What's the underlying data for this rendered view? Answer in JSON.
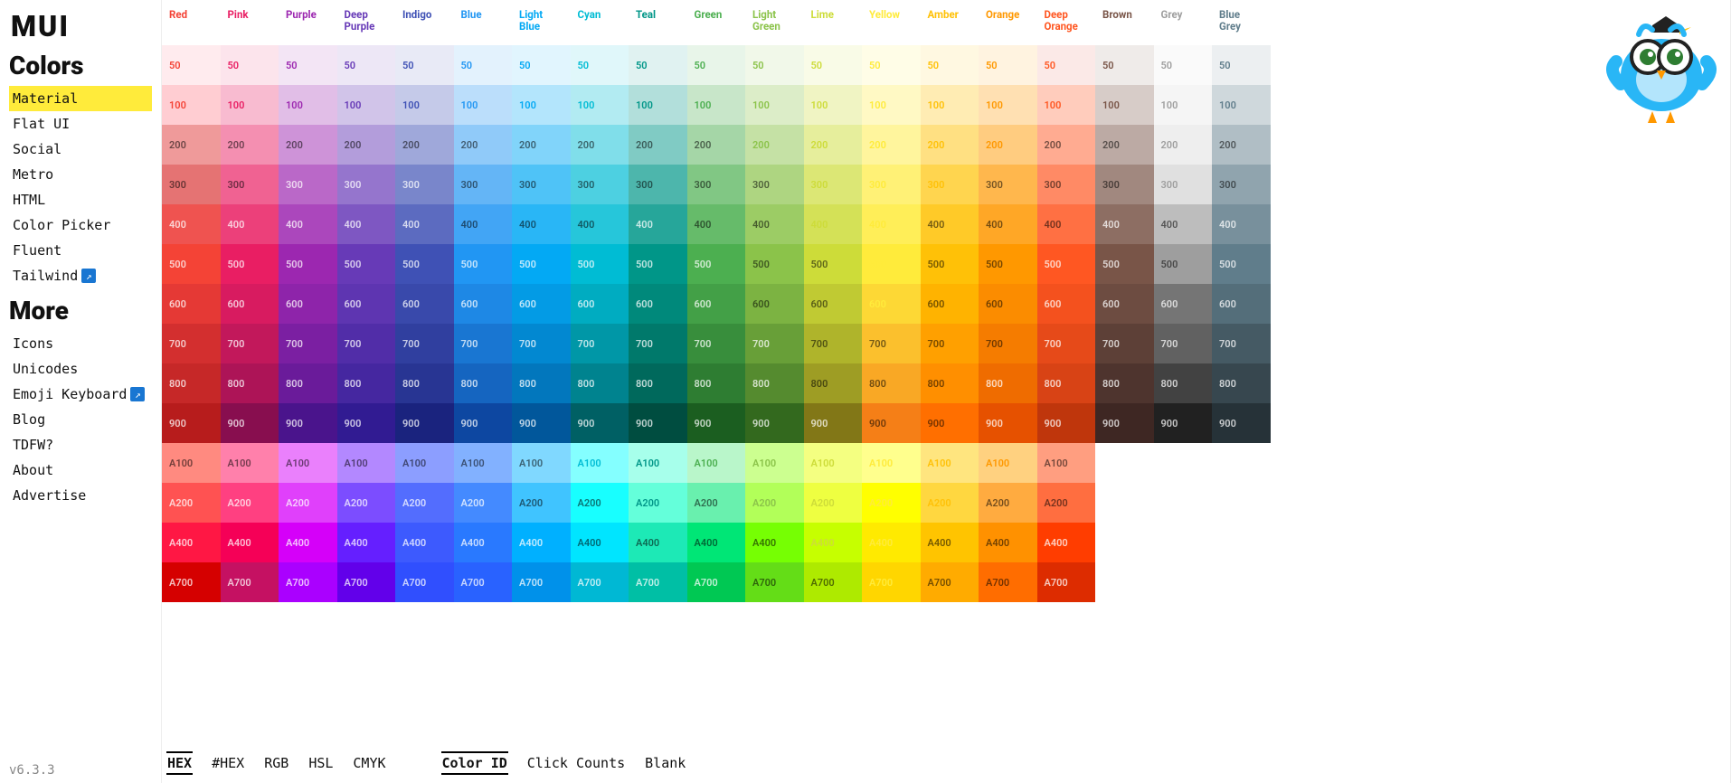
{
  "logo": "MUI",
  "sections": [
    {
      "title": "Colors",
      "items": [
        {
          "label": "Material",
          "active": true
        },
        {
          "label": "Flat UI"
        },
        {
          "label": "Social"
        },
        {
          "label": "Metro"
        },
        {
          "label": "HTML"
        },
        {
          "label": "Color Picker"
        },
        {
          "label": "Fluent"
        },
        {
          "label": "Tailwind",
          "ext": true
        }
      ]
    },
    {
      "title": "More",
      "items": [
        {
          "label": "Icons"
        },
        {
          "label": "Unicodes"
        },
        {
          "label": "Emoji Keyboard",
          "ext": true
        },
        {
          "label": "Blog"
        },
        {
          "label": "TDFW?"
        },
        {
          "label": "About"
        },
        {
          "label": "Advertise"
        }
      ]
    }
  ],
  "version": "v6.3.3",
  "footer": {
    "formats": [
      {
        "l": "HEX",
        "on": true
      },
      {
        "l": "#HEX"
      },
      {
        "l": "RGB"
      },
      {
        "l": "HSL"
      },
      {
        "l": "CMYK"
      }
    ],
    "modes": [
      {
        "l": "Color ID",
        "on": true
      },
      {
        "l": "Click Counts"
      },
      {
        "l": "Blank"
      }
    ]
  },
  "shades": [
    "50",
    "100",
    "200",
    "300",
    "400",
    "500",
    "600",
    "700",
    "800",
    "900",
    "A100",
    "A200",
    "A400",
    "A700"
  ],
  "colors": [
    {
      "name": "Red",
      "txt": "#f44336",
      "sw": {
        "50": "#ffebee",
        "100": "#ffcdd2",
        "200": "#ef9a9a",
        "300": "#e57373",
        "400": "#ef5350",
        "500": "#f44336",
        "600": "#e53935",
        "700": "#d32f2f",
        "800": "#c62828",
        "900": "#b71c1c",
        "A100": "#ff8a80",
        "A200": "#ff5252",
        "A400": "#ff1744",
        "A700": "#d50000"
      }
    },
    {
      "name": "Pink",
      "txt": "#e91e63",
      "sw": {
        "50": "#fce4ec",
        "100": "#f8bbd0",
        "200": "#f48fb1",
        "300": "#f06292",
        "400": "#ec407a",
        "500": "#e91e63",
        "600": "#d81b60",
        "700": "#c2185b",
        "800": "#ad1457",
        "900": "#880e4f",
        "A100": "#ff80ab",
        "A200": "#ff4081",
        "A400": "#f50057",
        "A700": "#c51162"
      }
    },
    {
      "name": "Purple",
      "txt": "#9c27b0",
      "sw": {
        "50": "#f3e5f5",
        "100": "#e1bee7",
        "200": "#ce93d8",
        "300": "#ba68c8",
        "400": "#ab47bc",
        "500": "#9c27b0",
        "600": "#8e24aa",
        "700": "#7b1fa2",
        "800": "#6a1b9a",
        "900": "#4a148c",
        "A100": "#ea80fc",
        "A200": "#e040fb",
        "A400": "#d500f9",
        "A700": "#aa00ff"
      }
    },
    {
      "name": "Deep Purple",
      "txt": "#673ab7",
      "sw": {
        "50": "#ede7f6",
        "100": "#d1c4e9",
        "200": "#b39ddb",
        "300": "#9575cd",
        "400": "#7e57c2",
        "500": "#673ab7",
        "600": "#5e35b1",
        "700": "#512da8",
        "800": "#4527a0",
        "900": "#311b92",
        "A100": "#b388ff",
        "A200": "#7c4dff",
        "A400": "#651fff",
        "A700": "#6200ea"
      }
    },
    {
      "name": "Indigo",
      "txt": "#3f51b5",
      "sw": {
        "50": "#e8eaf6",
        "100": "#c5cae9",
        "200": "#9fa8da",
        "300": "#7986cb",
        "400": "#5c6bc0",
        "500": "#3f51b5",
        "600": "#3949ab",
        "700": "#303f9f",
        "800": "#283593",
        "900": "#1a237e",
        "A100": "#8c9eff",
        "A200": "#536dfe",
        "A400": "#3d5afe",
        "A700": "#304ffe"
      }
    },
    {
      "name": "Blue",
      "txt": "#2196f3",
      "sw": {
        "50": "#e3f2fd",
        "100": "#bbdefb",
        "200": "#90caf9",
        "300": "#64b5f6",
        "400": "#42a5f5",
        "500": "#2196f3",
        "600": "#1e88e5",
        "700": "#1976d2",
        "800": "#1565c0",
        "900": "#0d47a1",
        "A100": "#82b1ff",
        "A200": "#448aff",
        "A400": "#2979ff",
        "A700": "#2962ff"
      }
    },
    {
      "name": "Light Blue",
      "txt": "#03a9f4",
      "sw": {
        "50": "#e1f5fe",
        "100": "#b3e5fc",
        "200": "#81d4fa",
        "300": "#4fc3f7",
        "400": "#29b6f6",
        "500": "#03a9f4",
        "600": "#039be5",
        "700": "#0288d1",
        "800": "#0277bd",
        "900": "#01579b",
        "A100": "#80d8ff",
        "A200": "#40c4ff",
        "A400": "#00b0ff",
        "A700": "#0091ea"
      }
    },
    {
      "name": "Cyan",
      "txt": "#00bcd4",
      "sw": {
        "50": "#e0f7fa",
        "100": "#b2ebf2",
        "200": "#80deea",
        "300": "#4dd0e1",
        "400": "#26c6da",
        "500": "#00bcd4",
        "600": "#00acc1",
        "700": "#0097a7",
        "800": "#00838f",
        "900": "#006064",
        "A100": "#84ffff",
        "A200": "#18ffff",
        "A400": "#00e5ff",
        "A700": "#00b8d4"
      }
    },
    {
      "name": "Teal",
      "txt": "#009688",
      "sw": {
        "50": "#e0f2f1",
        "100": "#b2dfdb",
        "200": "#80cbc4",
        "300": "#4db6ac",
        "400": "#26a69a",
        "500": "#009688",
        "600": "#00897b",
        "700": "#00796b",
        "800": "#00695c",
        "900": "#004d40",
        "A100": "#a7ffeb",
        "A200": "#64ffda",
        "A400": "#1de9b6",
        "A700": "#00bfa5"
      }
    },
    {
      "name": "Green",
      "txt": "#4caf50",
      "sw": {
        "50": "#e8f5e9",
        "100": "#c8e6c9",
        "200": "#a5d6a7",
        "300": "#81c784",
        "400": "#66bb6a",
        "500": "#4caf50",
        "600": "#43a047",
        "700": "#388e3c",
        "800": "#2e7d32",
        "900": "#1b5e20",
        "A100": "#b9f6ca",
        "A200": "#69f0ae",
        "A400": "#00e676",
        "A700": "#00c853"
      }
    },
    {
      "name": "Light Green",
      "txt": "#8bc34a",
      "sw": {
        "50": "#f1f8e9",
        "100": "#dcedc8",
        "200": "#c5e1a5",
        "300": "#aed581",
        "400": "#9ccc65",
        "500": "#8bc34a",
        "600": "#7cb342",
        "700": "#689f38",
        "800": "#558b2f",
        "900": "#33691e",
        "A100": "#ccff90",
        "A200": "#b2ff59",
        "A400": "#76ff03",
        "A700": "#64dd17"
      }
    },
    {
      "name": "Lime",
      "txt": "#cddc39",
      "sw": {
        "50": "#f9fbe7",
        "100": "#f0f4c3",
        "200": "#e6ee9c",
        "300": "#dce775",
        "400": "#d4e157",
        "500": "#cddc39",
        "600": "#c0ca33",
        "700": "#afb42b",
        "800": "#9e9d24",
        "900": "#827717",
        "A100": "#f4ff81",
        "A200": "#eeff41",
        "A400": "#c6ff00",
        "A700": "#aeea00"
      }
    },
    {
      "name": "Yellow",
      "txt": "#ffeb3b",
      "sw": {
        "50": "#fffde7",
        "100": "#fff9c4",
        "200": "#fff59d",
        "300": "#fff176",
        "400": "#ffee58",
        "500": "#ffeb3b",
        "600": "#fdd835",
        "700": "#fbc02d",
        "800": "#f9a825",
        "900": "#f57f17",
        "A100": "#ffff8d",
        "A200": "#ffff00",
        "A400": "#ffea00",
        "A700": "#ffd600"
      }
    },
    {
      "name": "Amber",
      "txt": "#ffc107",
      "sw": {
        "50": "#fff8e1",
        "100": "#ffecb3",
        "200": "#ffe082",
        "300": "#ffd54f",
        "400": "#ffca28",
        "500": "#ffc107",
        "600": "#ffb300",
        "700": "#ffa000",
        "800": "#ff8f00",
        "900": "#ff6f00",
        "A100": "#ffe57f",
        "A200": "#ffd740",
        "A400": "#ffc400",
        "A700": "#ffab00"
      }
    },
    {
      "name": "Orange",
      "txt": "#ff9800",
      "sw": {
        "50": "#fff3e0",
        "100": "#ffe0b2",
        "200": "#ffcc80",
        "300": "#ffb74d",
        "400": "#ffa726",
        "500": "#ff9800",
        "600": "#fb8c00",
        "700": "#f57c00",
        "800": "#ef6c00",
        "900": "#e65100",
        "A100": "#ffd180",
        "A200": "#ffab40",
        "A400": "#ff9100",
        "A700": "#ff6d00"
      }
    },
    {
      "name": "Deep Orange",
      "txt": "#ff5722",
      "sw": {
        "50": "#fbe9e7",
        "100": "#ffccbc",
        "200": "#ffab91",
        "300": "#ff8a65",
        "400": "#ff7043",
        "500": "#ff5722",
        "600": "#f4511e",
        "700": "#e64a19",
        "800": "#d84315",
        "900": "#bf360c",
        "A100": "#ff9e80",
        "A200": "#ff6e40",
        "A400": "#ff3d00",
        "A700": "#dd2c00"
      }
    },
    {
      "name": "Brown",
      "txt": "#795548",
      "sw": {
        "50": "#efebe9",
        "100": "#d7ccc8",
        "200": "#bcaaa4",
        "300": "#a1887f",
        "400": "#8d6e63",
        "500": "#795548",
        "600": "#6d4c41",
        "700": "#5d4037",
        "800": "#4e342e",
        "900": "#3e2723"
      }
    },
    {
      "name": "Grey",
      "txt": "#9e9e9e",
      "sw": {
        "50": "#fafafa",
        "100": "#f5f5f5",
        "200": "#eeeeee",
        "300": "#e0e0e0",
        "400": "#bdbdbd",
        "500": "#9e9e9e",
        "600": "#757575",
        "700": "#616161",
        "800": "#424242",
        "900": "#212121"
      }
    },
    {
      "name": "Blue Grey",
      "txt": "#607d8b",
      "sw": {
        "50": "#eceff1",
        "100": "#cfd8dc",
        "200": "#b0bec5",
        "300": "#90a4ae",
        "400": "#78909c",
        "500": "#607d8b",
        "600": "#546e7a",
        "700": "#455a64",
        "800": "#37474f",
        "900": "#263238"
      }
    }
  ]
}
